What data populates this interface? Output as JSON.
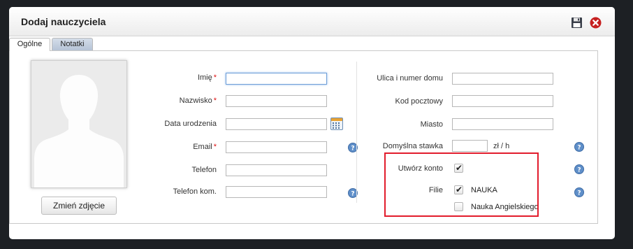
{
  "dialog": {
    "title": "Dodaj nauczyciela"
  },
  "header_icons": [
    "save-icon",
    "close-icon"
  ],
  "tabs": [
    {
      "label": "Ogólne",
      "active": true
    },
    {
      "label": "Notatki",
      "active": false
    }
  ],
  "photo": {
    "button_label": "Zmień zdjęcie"
  },
  "left_form": {
    "imie": {
      "label": "Imię",
      "required": "*",
      "value": ""
    },
    "nazwisko": {
      "label": "Nazwisko",
      "required": "*",
      "value": ""
    },
    "data_urodzenia": {
      "label": "Data urodzenia",
      "value": ""
    },
    "email": {
      "label": "Email",
      "required": "*",
      "value": ""
    },
    "telefon": {
      "label": "Telefon",
      "value": ""
    },
    "telefon_kom": {
      "label": "Telefon kom.",
      "value": ""
    }
  },
  "right_form": {
    "ulica": {
      "label": "Ulica i numer domu",
      "value": ""
    },
    "kod": {
      "label": "Kod pocztowy",
      "value": ""
    },
    "miasto": {
      "label": "Miasto",
      "value": ""
    },
    "stawka": {
      "label": "Domyślna stawka",
      "value": "",
      "unit": "zł / h"
    },
    "utworz_konto": {
      "label": "Utwórz konto",
      "checked": true
    },
    "filie": {
      "label": "Filie",
      "options": [
        {
          "label": "NAUKA",
          "checked": true
        },
        {
          "label": "Nauka Angielskiego",
          "checked": false
        }
      ]
    }
  },
  "colors": {
    "highlight": "#e21c2c",
    "required": "#d11111",
    "tab_inactive": "#b5c3d6",
    "background": "#1d2024"
  }
}
